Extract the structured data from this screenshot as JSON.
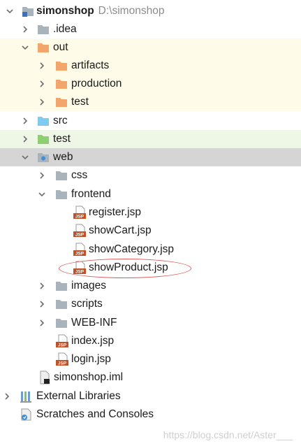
{
  "project": {
    "name": "simonshop",
    "path": "D:\\simonshop"
  },
  "tree": {
    "idea": ".idea",
    "out": "out",
    "artifacts": "artifacts",
    "production": "production",
    "out_test": "test",
    "src": "src",
    "test": "test",
    "web": "web",
    "css": "css",
    "frontend": "frontend",
    "register": "register.jsp",
    "showCart": "showCart.jsp",
    "showCategory": "showCategory.jsp",
    "showProduct": "showProduct.jsp",
    "images": "images",
    "scripts": "scripts",
    "webinf": "WEB-INF",
    "index": "index.jsp",
    "login": "login.jsp",
    "iml": "simonshop.iml",
    "extlib": "External Libraries",
    "scratches": "Scratches and Consoles"
  },
  "icons": {
    "project": "module-folder-icon",
    "folder": "folder-icon",
    "source": "source-folder-icon",
    "test": "test-folder-icon",
    "web": "web-folder-icon",
    "jsp": "jsp-file-icon",
    "iml": "iml-file-icon",
    "library": "library-icon",
    "scratch": "scratch-icon"
  },
  "colors": {
    "folder": "#a9b3bc",
    "excluded": "#f2a66c",
    "source": "#7ecbef",
    "test": "#8fcf74",
    "selection": "#d5d5d5",
    "annotation": "#e05a5a"
  },
  "watermark": "https://blog.csdn.net/Aster___"
}
